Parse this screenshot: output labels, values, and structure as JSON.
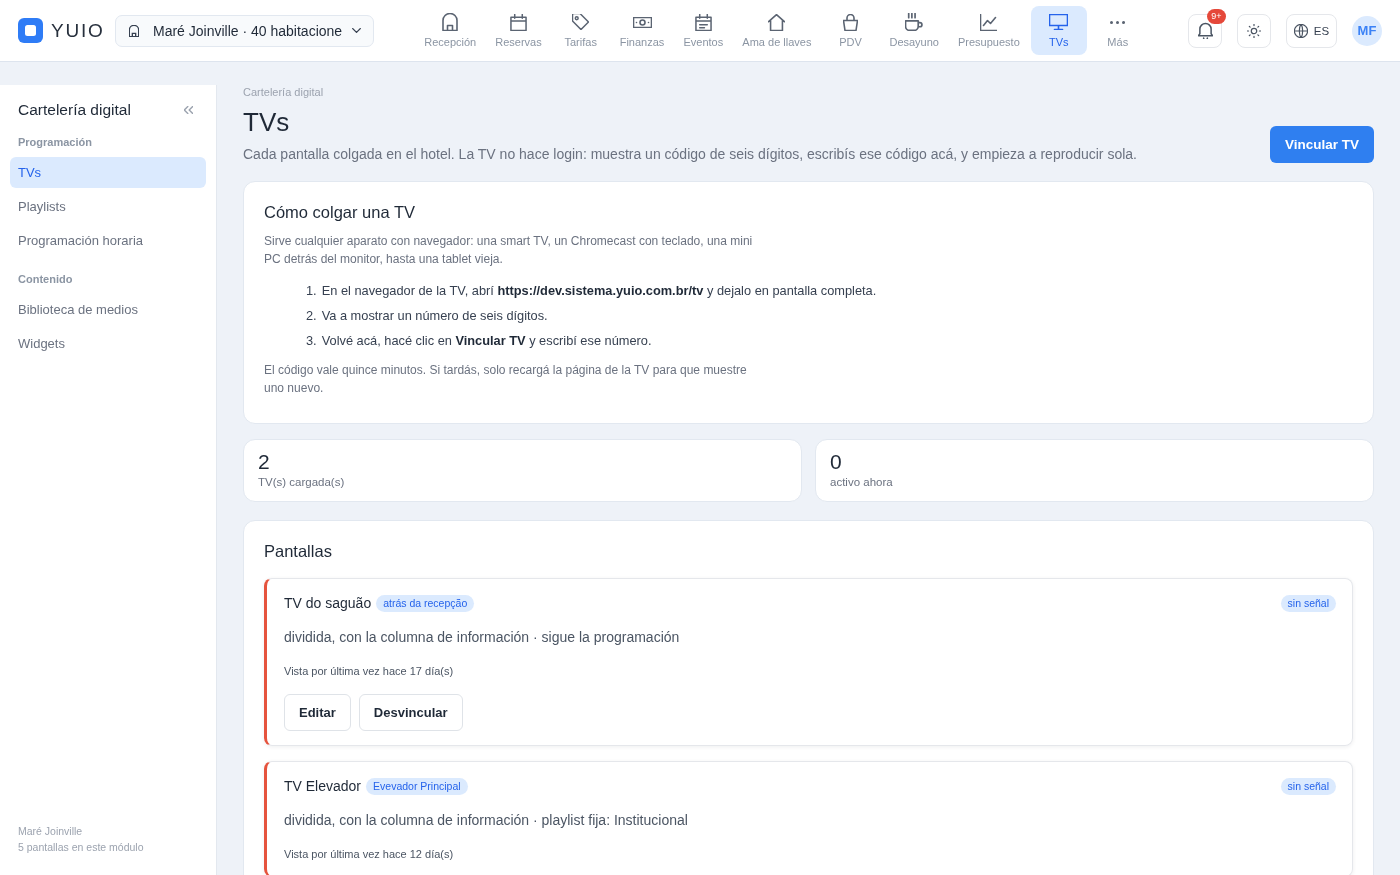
{
  "topbar": {
    "logo": "YUIO",
    "property": "Maré Joinville · 40 habitacione",
    "nav": [
      {
        "label": "Recepción",
        "selected": false
      },
      {
        "label": "Reservas",
        "selected": false
      },
      {
        "label": "Tarifas",
        "selected": false
      },
      {
        "label": "Finanzas",
        "selected": false
      },
      {
        "label": "Eventos",
        "selected": false
      },
      {
        "label": "Ama de llaves",
        "selected": false
      },
      {
        "label": "PDV",
        "selected": false
      },
      {
        "label": "Desayuno",
        "selected": false
      },
      {
        "label": "Presupuesto",
        "selected": false
      },
      {
        "label": "TVs",
        "selected": true
      },
      {
        "label": "Más",
        "selected": false
      }
    ],
    "notifications_badge": "9+",
    "language": "ES",
    "avatar": "MF"
  },
  "sidebar": {
    "title": "Cartelería digital",
    "sections": [
      {
        "heading": "Programación",
        "items": [
          {
            "label": "TVs",
            "selected": true
          },
          {
            "label": "Playlists",
            "selected": false
          },
          {
            "label": "Programación horaria",
            "selected": false
          }
        ]
      },
      {
        "heading": "Contenido",
        "items": [
          {
            "label": "Biblioteca de medios",
            "selected": false
          },
          {
            "label": "Widgets",
            "selected": false
          }
        ]
      }
    ],
    "footer": [
      "Maré Joinville",
      "5 pantallas en este módulo"
    ]
  },
  "page": {
    "breadcrumb": "Cartelería digital",
    "title": "TVs",
    "description": "Cada pantalla colgada en el hotel. La TV no hace login: muestra un código de seis dígitos, escribís ese código acá, y empieza a reproducir sola.",
    "primary_button": "Vincular TV"
  },
  "guide": {
    "title": "Cómo colgar una TV",
    "intro": "Sirve cualquier aparato con navegador: una smart TV, un Chromecast con teclado, una mini PC detrás del monitor, hasta una tablet vieja.",
    "steps": [
      {
        "number": "1.",
        "text": "En el navegador de la TV, abrí **https://dev.sistema.yuio.com.br/tv** y dejalo en pantalla completa."
      },
      {
        "number": "2.",
        "text": "Va a mostrar un número de seis dígitos."
      },
      {
        "number": "3.",
        "text": "Volvé acá, hacé clic en **Vincular TV** y escribí ese número."
      }
    ],
    "note": "El código vale quince minutos. Si tardás, solo recargá la página de la TV para que muestre uno nuevo."
  },
  "stats": [
    {
      "value": "2",
      "label": "TV(s) cargada(s)"
    },
    {
      "value": "0",
      "label": "activo ahora"
    }
  ],
  "screens": {
    "title": "Pantallas",
    "items": [
      {
        "name": "TV do saguão",
        "location": "atrás da recepção",
        "status": "sin señal",
        "online": false,
        "description": "dividida, con la columna de información · sigue la programación",
        "last_seen": "Vista por última vez hace 17 día(s)",
        "actions": [
          "Editar",
          "Desvincular"
        ]
      },
      {
        "name": "TV Elevador",
        "location": "Evevador Principal",
        "status": "sin señal",
        "online": false,
        "description": "dividida, con la columna de información · playlist fija: Institucional",
        "last_seen": "Vista por última vez hace 12 día(s)"
      }
    ]
  }
}
